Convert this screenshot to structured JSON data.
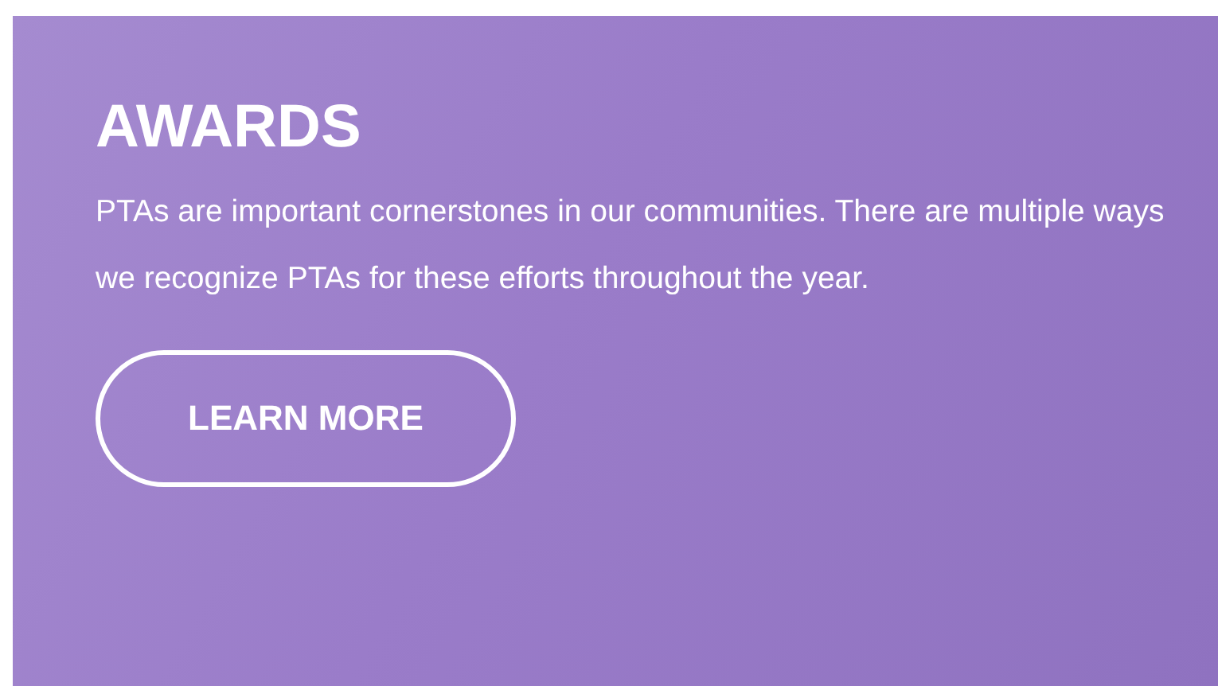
{
  "card": {
    "title": "AWARDS",
    "description": "PTAs are important cornerstones in our communities. There are multiple ways we recognize PTAs for these efforts throughout the year.",
    "button": "LEARN MORE"
  }
}
